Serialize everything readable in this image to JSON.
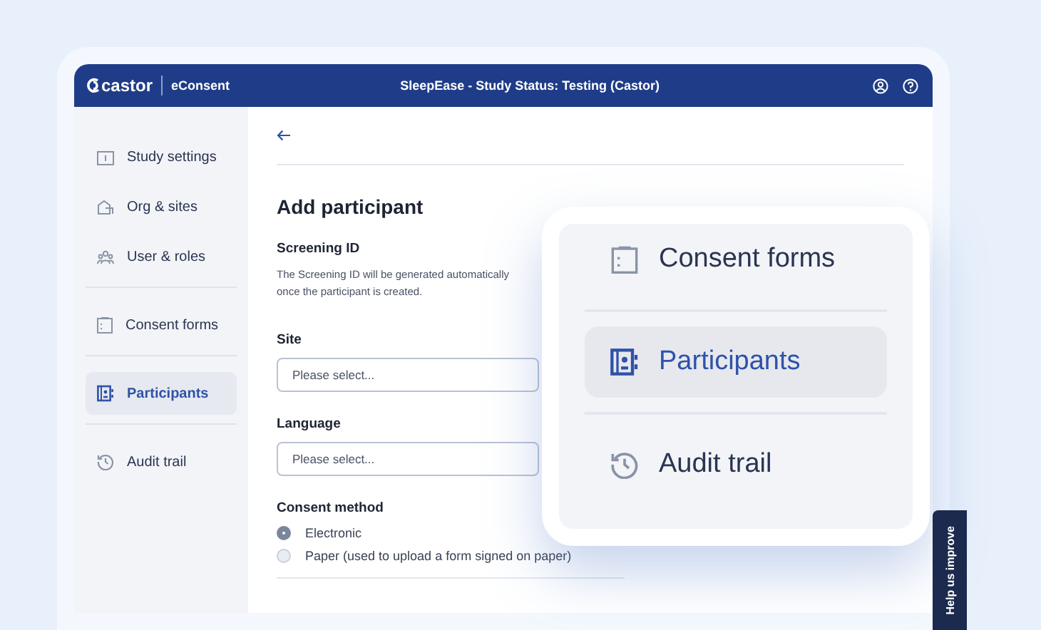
{
  "header": {
    "logo": "castor",
    "product": "eConsent",
    "title": "SleepEase  - Study Status: Testing (Castor)"
  },
  "sidebar": {
    "groups": [
      [
        {
          "label": "Study settings",
          "selected": false
        },
        {
          "label": "Org & sites",
          "selected": false
        },
        {
          "label": "User & roles",
          "selected": false
        }
      ],
      [
        {
          "label": "Consent forms",
          "selected": false
        }
      ],
      [
        {
          "label": "Participants",
          "selected": true
        }
      ],
      [
        {
          "label": "Audit trail",
          "selected": false
        }
      ]
    ]
  },
  "form": {
    "title": "Add participant",
    "screening": {
      "label": "Screening ID",
      "help": "The Screening ID will be generated automatically once the participant is created."
    },
    "fields": [
      {
        "label": "Site",
        "placeholder": "Please select..."
      },
      {
        "label": "Language",
        "placeholder": "Please select..."
      }
    ],
    "consent_method": {
      "label": "Consent method",
      "options": [
        {
          "label": "Electronic",
          "selected": true
        },
        {
          "label": "Paper (used to upload a form signed on paper)",
          "selected": false
        }
      ]
    }
  },
  "zoom_callout": {
    "items": [
      {
        "label": "Consent forms",
        "selected": false
      },
      {
        "label": "Participants",
        "selected": true
      },
      {
        "label": "Audit trail",
        "selected": false
      }
    ]
  },
  "feedback_tab": {
    "label": "Help us improve"
  }
}
